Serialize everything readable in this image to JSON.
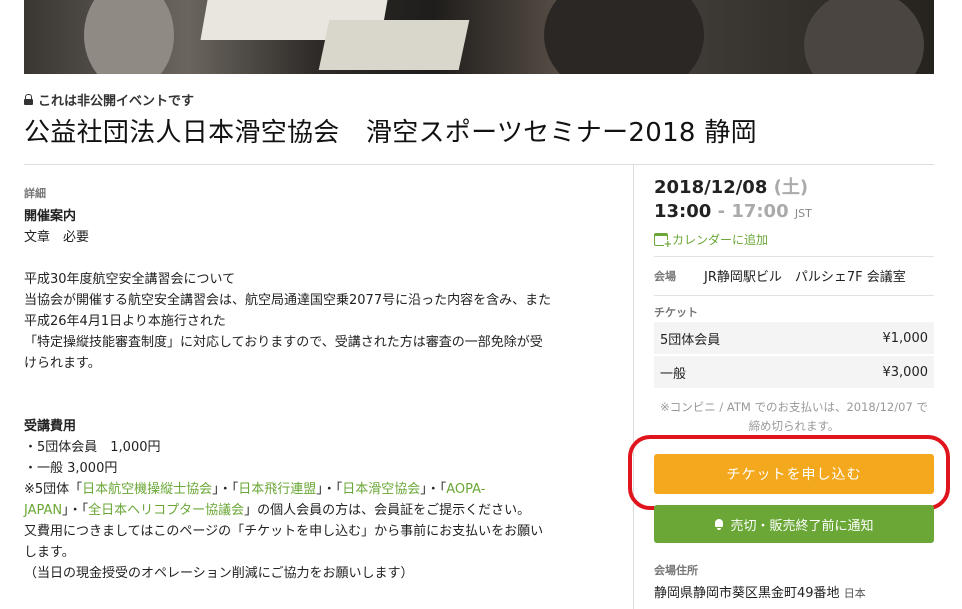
{
  "event": {
    "private_notice": "これは非公開イベントです",
    "title": "公益社団法人日本滑空協会　滑空スポーツセミナー2018 静岡"
  },
  "detail": {
    "section_label": "詳細",
    "heading": "開催案内",
    "line1": "文章　必要",
    "para1": [
      "平成30年度航空安全講習会について",
      "当協会が開催する航空安全講習会は、航空局通達国空乗2077号に沿った内容を含み、また",
      "平成26年4月1日より本施行された",
      "「特定操縦技能審査制度」に対応しておりますので、受講された方は審査の一部免除が受",
      "けられます。"
    ],
    "fee_heading": "受講費用",
    "fee1": "・5団体会員　1,000円",
    "fee2": "・一般 3,000円",
    "note_prefix": "※5団体「",
    "org1": "日本航空機操縦士協会",
    "sep1": "」・「",
    "org2": "日本飛行連盟",
    "sep2": "」・「",
    "org3": "日本滑空協会",
    "sep3": "」・「",
    "org4a": "AOPA-",
    "org4b": "JAPAN",
    "sep4": "」・「",
    "org5": "全日本ヘリコプター協議会",
    "note_suffix": "」の個人会員の方は、会員証をご提示ください。",
    "line_a": "又費用につきましてはこのページの「チケットを申し込む」から事前にお支払いをお願い",
    "line_b": "します。",
    "line_c": "（当日の現金授受のオペレーション削減にご協力をお願いします）"
  },
  "sidebar": {
    "date": "2018/12/08",
    "day": "(土)",
    "time_start": "13:00",
    "time_dash": " - ",
    "time_end": "17:00",
    "tz": "JST",
    "calendar_link": "カレンダーに追加",
    "venue_label": "会場",
    "venue_value": "JR静岡駅ビル　パルシェ7F 会議室",
    "ticket_label": "チケット",
    "tickets": [
      {
        "name": "5団体会員",
        "price": "¥1,000"
      },
      {
        "name": "一般",
        "price": "¥3,000"
      }
    ],
    "ticket_note_1": "※コンビニ / ATM でのお支払いは、2018/12/07 で",
    "ticket_note_2": "締め切られます。",
    "apply_button": "チケットを申し込む",
    "notify_button": "売切・販売終了前に通知",
    "address_label": "会場住所",
    "address": "静岡県静岡市葵区黒金町49番地",
    "country": "日本"
  },
  "colors": {
    "accent_green": "#6aa736",
    "apply_orange": "#f4a81d",
    "highlight_red": "#e0141d"
  },
  "icons": [
    "lock-icon",
    "calendar-plus-icon",
    "bell-icon"
  ]
}
